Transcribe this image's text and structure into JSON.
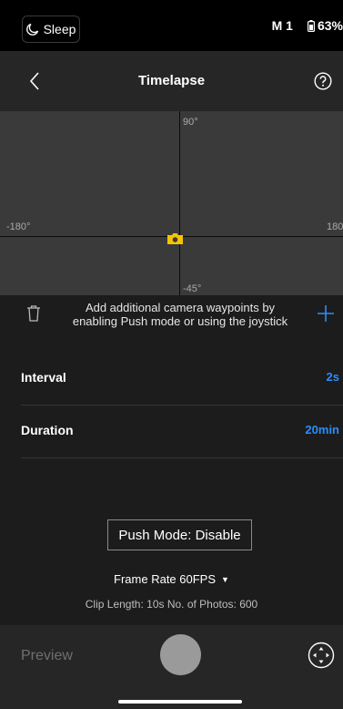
{
  "status_bar": {
    "sleep_label": "Sleep",
    "mode_label": "M 1",
    "battery_label": "63%"
  },
  "header": {
    "title": "Timelapse"
  },
  "gimbal_graph": {
    "label_top": "90°",
    "label_left": "-180°",
    "label_right": "180",
    "label_bottom": "-45°",
    "marker_color": "#f5c400"
  },
  "waypoints": {
    "hint": "Add additional camera waypoints by enabling Push mode or using the joystick"
  },
  "settings": [
    {
      "label": "Interval",
      "value": "2s"
    },
    {
      "label": "Duration",
      "value": "20min"
    }
  ],
  "push_mode": {
    "label": "Push Mode: Disable"
  },
  "frame_rate": {
    "label": "Frame Rate 60FPS"
  },
  "clip_info": {
    "text": "Clip Length: 10s  No. of Photos: 600"
  },
  "bottom": {
    "preview_label": "Preview"
  },
  "colors": {
    "accent": "#2b8dfc",
    "background": "#1c1c1c",
    "panel": "#262626"
  }
}
